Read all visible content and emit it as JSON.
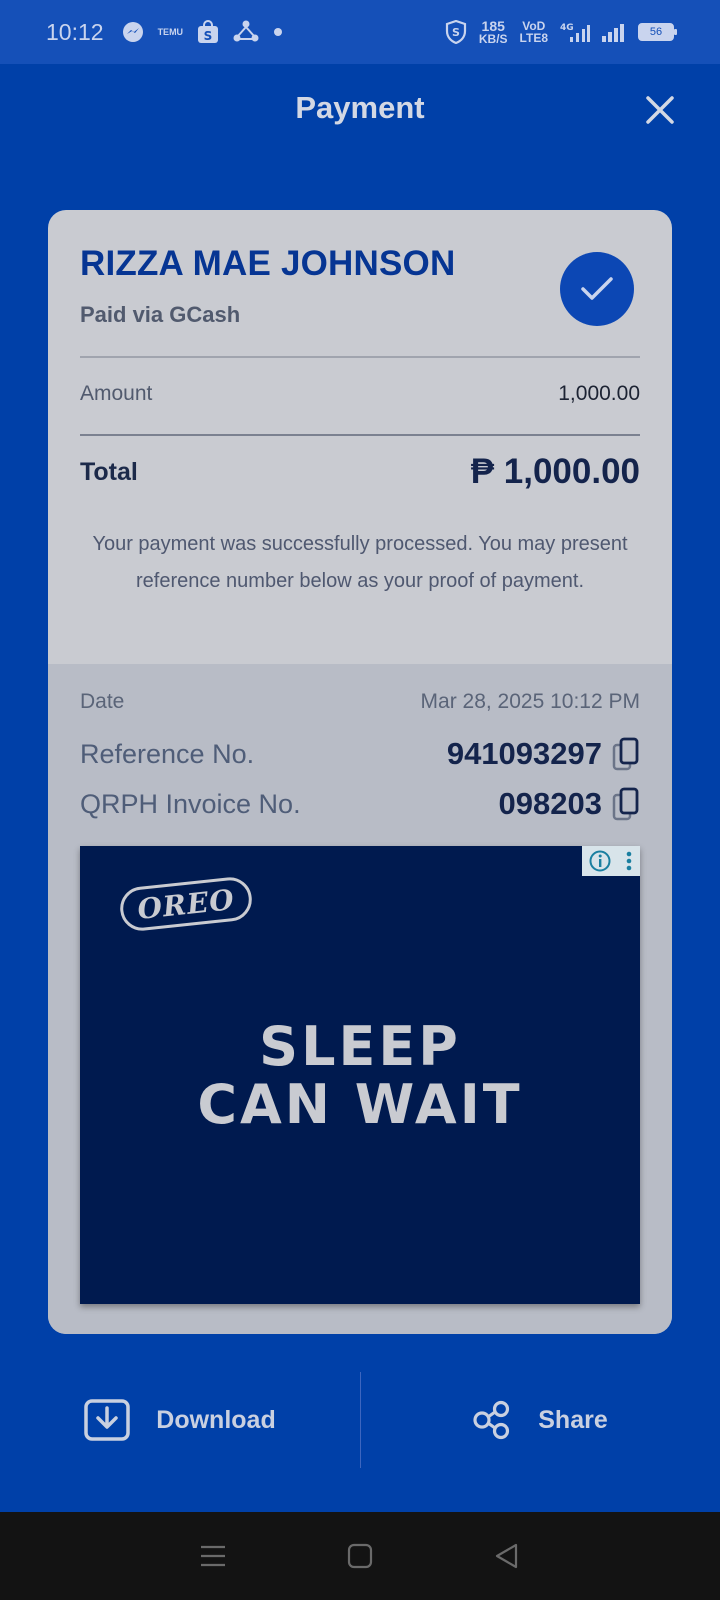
{
  "status_bar": {
    "time": "10:12",
    "temu_label": "TEMU",
    "shop_label": "S",
    "speed_value": "185",
    "speed_unit": "KB/S",
    "volte_top": "VoD",
    "volte_bottom": "LTE8",
    "network": "4G",
    "battery": "56"
  },
  "header": {
    "title": "Payment"
  },
  "receipt": {
    "name": "RIZZA MAE JOHNSON",
    "paid_via": "Paid via GCash",
    "amount_label": "Amount",
    "amount_value": "1,000.00",
    "total_label": "Total",
    "total_value": "₱ 1,000.00",
    "message": "Your payment was successfully processed. You may present reference number below as your proof of payment.",
    "date_label": "Date",
    "date_value": "Mar 28, 2025 10:12 PM",
    "reference_label": "Reference No.",
    "reference_value": "941093297",
    "invoice_label": "QRPH Invoice No.",
    "invoice_value": "098203"
  },
  "ad": {
    "brand": "OREO",
    "line1": "SLEEP",
    "line2": "CAN WAIT"
  },
  "actions": {
    "download_label": "Download",
    "share_label": "Share"
  },
  "colors": {
    "background": "#0040a8",
    "card": "#c9cbd1",
    "accent": "#0c47b4",
    "ad_background": "#001a4f"
  }
}
